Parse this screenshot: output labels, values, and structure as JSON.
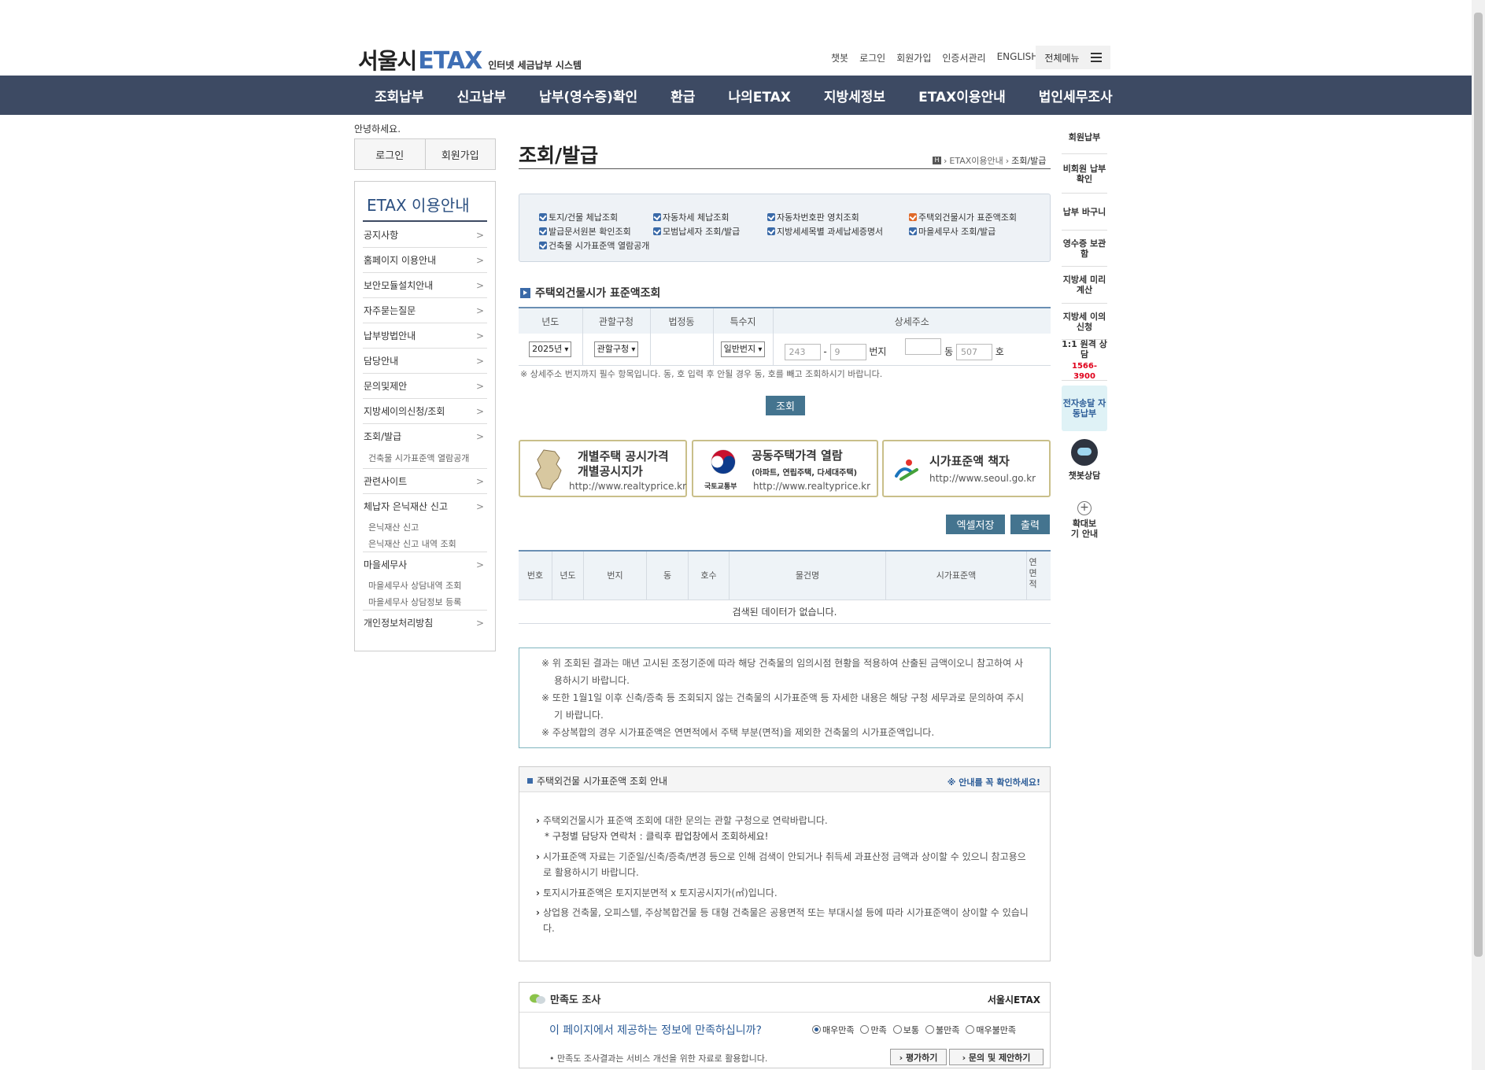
{
  "header": {
    "logo_main": "서울시",
    "logo_brand": "ETAX",
    "logo_sub": "인터넷 세금납부 시스템",
    "top_links": [
      "챗봇",
      "로그인",
      "회원가입",
      "인증서관리",
      "ENGLISH"
    ],
    "all_menu": "전체메뉴"
  },
  "gnb": [
    "조회납부",
    "신고납부",
    "납부(영수증)확인",
    "환급",
    "나의ETAX",
    "지방세정보",
    "ETAX이용안내",
    "법인세무조사"
  ],
  "sidebar": {
    "greeting": "안녕하세요.",
    "login": "로그인",
    "join": "회원가입",
    "title": "ETAX 이용안내",
    "items": [
      "공지사항",
      "홈페이지 이용안내",
      "보안모듈설치안내",
      "자주묻는질문",
      "납부방법안내",
      "담당안내",
      "문의및제안",
      "지방세이의신청/조회",
      "조회/발급"
    ],
    "sub1": "건축물 시가표준액 열람공개",
    "items2": [
      "관련사이트",
      "체납자 은닉재산 신고"
    ],
    "sub2": [
      "은닉재산 신고",
      "은닉재산 신고 내역 조회"
    ],
    "item3": "마을세무사",
    "sub3": [
      "마을세무사 상담내역 조회",
      "마을세무사 상담정보 등록"
    ],
    "item4": "개인정보처리방침"
  },
  "page": {
    "title": "조회/발급",
    "breadcrumb_parent": "ETAX이용안내",
    "breadcrumb_current": "조회/발급"
  },
  "links": [
    "토지/건물 체납조회",
    "자동차세 체납조회",
    "자동차번호판 영치조회",
    "주택외건물시가 표준액조회",
    "발급문서원본 확인조회",
    "모범납세자 조회/발급",
    "지방세세목별 과세납세증명서",
    "마을세무사 조회/발급",
    "건축물 시가표준액 열람공개"
  ],
  "search": {
    "section_title": "주택외건물시가 표준액조회",
    "cols": [
      "년도",
      "관할구청",
      "법정동",
      "특수지",
      "상세주소"
    ],
    "year": "2025년",
    "gu": "관할구청",
    "special": "일반번지",
    "bun": "243",
    "ji": "9",
    "dong": "",
    "ho": "507",
    "lbl_bunji": "번지",
    "lbl_dong": "동",
    "lbl_ho": "호",
    "dash": "-",
    "note": "※ 상세주소 번지까지 필수 항목입니다. 동, 호 입력 후 안될 경우 동, 호를 빼고 조회하시기 바랍니다.",
    "button": "조회"
  },
  "banners": [
    {
      "t1": "개별주택 공시가격",
      "t2": "개별공시지가",
      "url": "http://www.realtyprice.kr"
    },
    {
      "t1": "공동주택가격 열람",
      "t2": "(아파트, 연립주택, 다세대주택)",
      "url": "http://www.realtyprice.kr",
      "org": "국토교통부"
    },
    {
      "t1": "시가표준액 책자",
      "url": "http://www.seoul.go.kr"
    }
  ],
  "actions": {
    "excel": "엑셀저장",
    "print": "출력"
  },
  "result": {
    "cols": [
      "번호",
      "년도",
      "번지",
      "동",
      "호수",
      "물건명",
      "시가표준액",
      "연면적"
    ],
    "empty": "검색된 데이터가 없습니다."
  },
  "notices": [
    "※ 위 조회된 결과는 매년 고시된 조정기준에 따라 해당 건축물의 임의시점 현황을 적용하여 산출된 금액이오니 참고하여 사용하시기 바랍니다.",
    "※ 또한 1월1일 이후 신축/증축 등 조회되지 않는 건축물의 시가표준액 등 자세한 내용은 해당 구청 세무과로 문의하여 주시기 바랍니다.",
    "※ 주상복합의 경우 시가표준액은 연면적에서 주택 부분(면적)을 제외한 건축물의 시가표준액입니다."
  ],
  "guide": {
    "title": "주택외건물 시가표준액 조회 안내",
    "right": "※ 안내를 꼭 확인하세요!",
    "items": [
      "주택외건물시가 표준액 조회에 대한 문의는 관할 구청으로 연락바랍니다.",
      "* 구청별 담당자 연락처 : 클릭후 팝업창에서 조회하세요!",
      "시가표준액 자료는 기준일/신축/증축/변경 등으로 인해 검색이 안되거나 취득세 과표산정 금액과 상이할 수 있으니 참고용으로 활용하시기 바랍니다.",
      "토지시가표준액은 토지지분면적 x 토지공시지가(㎡)입니다.",
      "상업용 건축물, 오피스텔, 주상복합건물 등 대형 건축물은 공용면적 또는 부대시설 등에 따라 시가표준액이 상이할 수 있습니다."
    ]
  },
  "survey": {
    "title": "만족도 조사",
    "brand": "서울시ETAX",
    "question": "이 페이지에서 제공하는 정보에 만족하십니까?",
    "options": [
      "매우만족",
      "만족",
      "보통",
      "불만족",
      "매우불만족"
    ],
    "note": "• 만족도 조사결과는 서비스 개선을 위한 자료로 활용합니다.",
    "btn_eval": "› 평가하기",
    "btn_suggest": "› 문의 및 제안하기"
  },
  "quick": {
    "items": [
      "회원납부",
      "비회원 납부확인",
      "납부 바구니",
      "영수증 보관함",
      "지방세 미리계산",
      "지방세 이의신청",
      "1:1 원격 상담"
    ],
    "phone": "1566-3900",
    "highlight": "전자송달 자동납부",
    "chatbot": "챗봇상담",
    "zoom": "확대보기 안내"
  }
}
